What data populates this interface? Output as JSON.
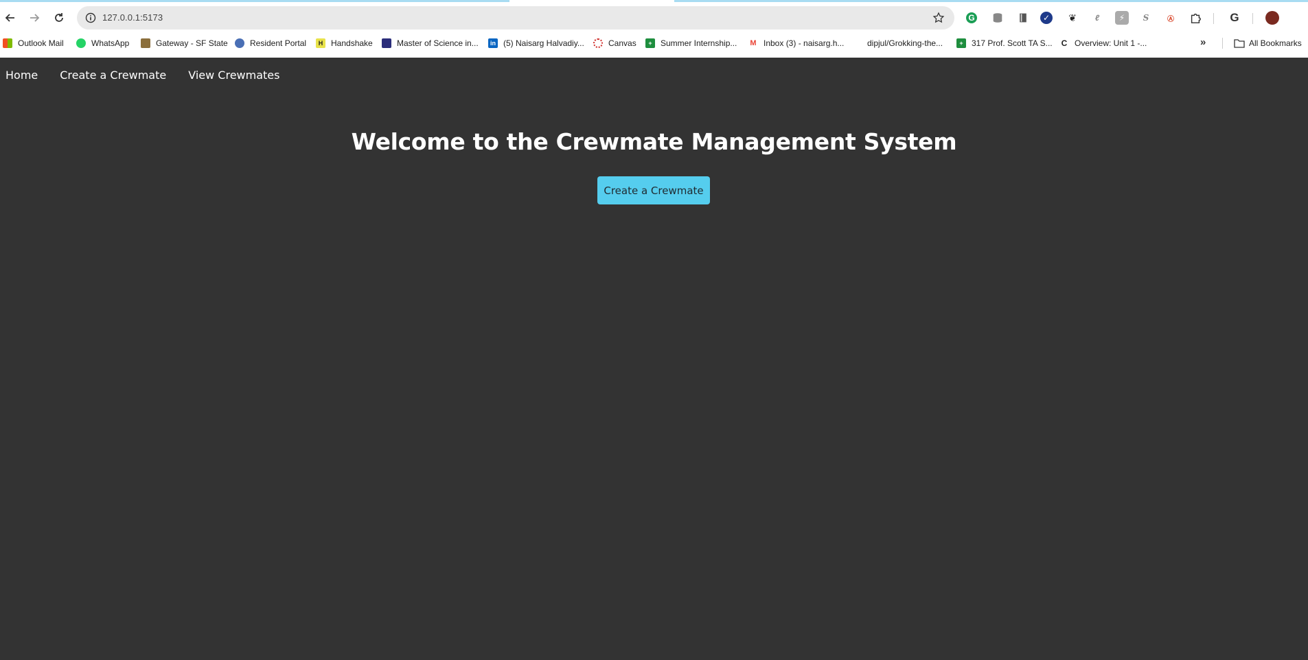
{
  "browser": {
    "url": "127.0.0.1:5173",
    "bookmarks": [
      {
        "label": "Outlook Mail",
        "icon": "ms-icon"
      },
      {
        "label": "WhatsApp",
        "icon": "whatsapp-icon"
      },
      {
        "label": "Gateway - SF State",
        "icon": "sfstate-icon"
      },
      {
        "label": "Resident Portal",
        "icon": "portal-icon"
      },
      {
        "label": "Handshake",
        "icon": "handshake-icon"
      },
      {
        "label": "Master of Science in...",
        "icon": "university-icon"
      },
      {
        "label": "(5) Naisarg Halvadiy...",
        "icon": "linkedin-icon"
      },
      {
        "label": "Canvas",
        "icon": "canvas-icon"
      },
      {
        "label": "Summer Internship...",
        "icon": "sheets-icon"
      },
      {
        "label": "Inbox (3) - naisarg.h...",
        "icon": "gmail-icon"
      },
      {
        "label": "dipjul/Grokking-the...",
        "icon": ""
      },
      {
        "label": "317 Prof. Scott TA S...",
        "icon": "sheets-icon"
      },
      {
        "label": "Overview: Unit 1 -...",
        "icon": "codepath-icon"
      }
    ],
    "all_bookmarks": "All Bookmarks"
  },
  "nav": {
    "home": "Home",
    "create": "Create a Crewmate",
    "view": "View Crewmates"
  },
  "hero": {
    "title": "Welcome to the Crewmate Management System",
    "button": "Create a Crewmate"
  }
}
